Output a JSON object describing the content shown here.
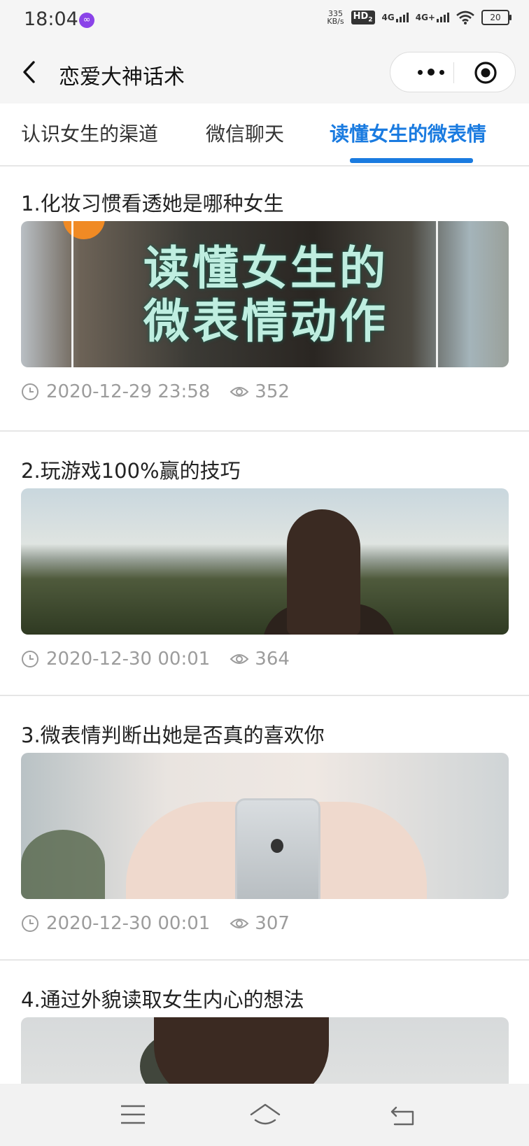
{
  "status_bar": {
    "time": "18:04",
    "badge_glyph": "∞",
    "net_speed_value": "335",
    "net_speed_unit": "KB/s",
    "hd_label": "HD",
    "hd_sub": "2",
    "sim1_label": "4G",
    "sim2_label": "4G+",
    "battery": "20"
  },
  "nav": {
    "title": "恋爱大神话术"
  },
  "tabs": [
    {
      "label": "认识女生的渠道",
      "active": false
    },
    {
      "label": "微信聊天",
      "active": false
    },
    {
      "label": "读懂女生的微表情",
      "active": true
    }
  ],
  "articles": [
    {
      "title": "1.化妆习惯看透她是哪种女生",
      "thumb_text_line1": "读懂女生的",
      "thumb_text_line2": "微表情动作",
      "date": "2020-12-29 23:58",
      "views": "352"
    },
    {
      "title": "2.玩游戏100%赢的技巧",
      "date": "2020-12-30 00:01",
      "views": "364"
    },
    {
      "title": "3.微表情判断出她是否真的喜欢你",
      "date": "2020-12-30 00:01",
      "views": "307"
    },
    {
      "title": "4.通过外貌读取女生内心的想法"
    }
  ],
  "colors": {
    "accent": "#1a7be0",
    "meta_text": "#9c9c9c",
    "chrome_bg": "#f5f5f5"
  },
  "icons": {
    "back": "chevron-left-icon",
    "more": "more-dots-icon",
    "close": "target-circle-icon",
    "clock": "clock-icon",
    "eye": "eye-icon",
    "menu": "menu-icon",
    "home": "home-icon",
    "return": "return-icon"
  }
}
